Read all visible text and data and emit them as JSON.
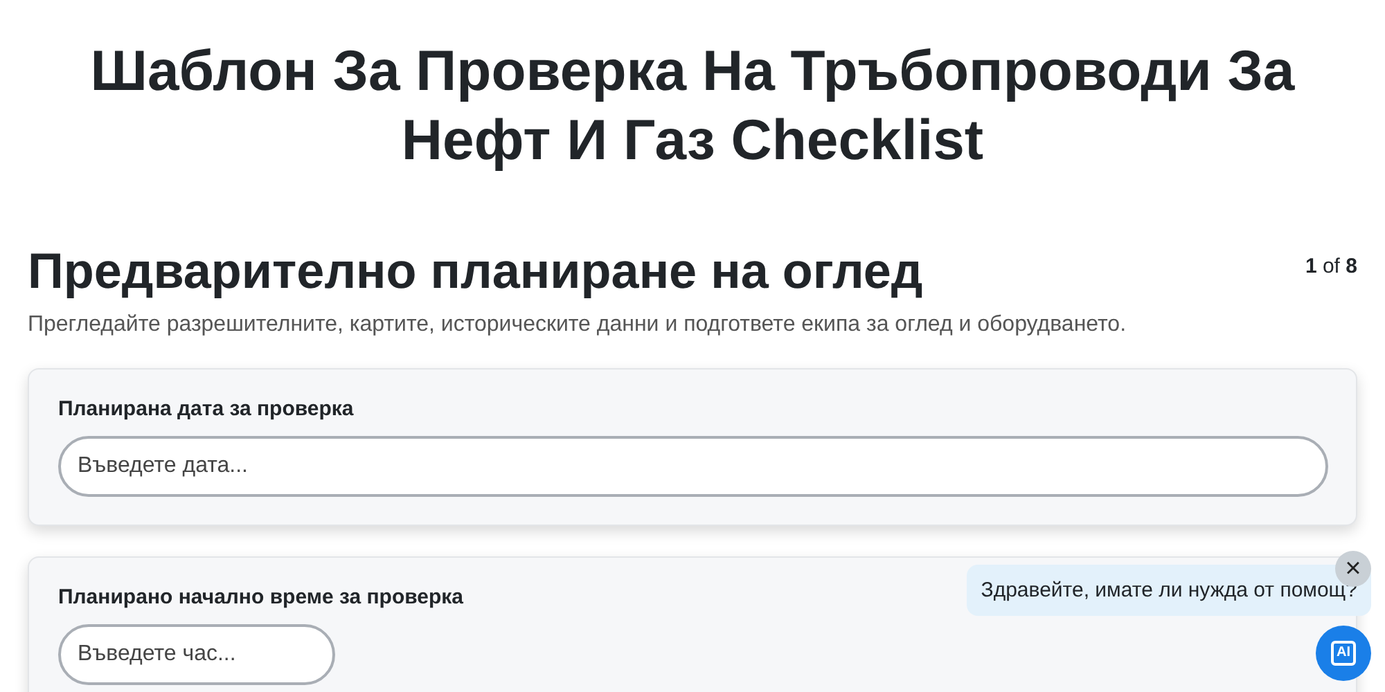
{
  "title": "Шаблон За Проверка На Тръбопроводи За Нефт И Газ Checklist",
  "section": {
    "heading": "Предварително планиране на оглед",
    "page": "1",
    "page_sep": "of",
    "page_total": "8",
    "description": "Прегледайте разрешителните, картите, историческите данни и подгответе екипа за оглед и оборудването."
  },
  "fields": [
    {
      "label": "Планирана дата за проверка",
      "placeholder": "Въведете дата...",
      "kind": "wide"
    },
    {
      "label": "Планирано начално време за проверка",
      "placeholder": "Въведете час...",
      "kind": "short"
    }
  ],
  "chat": {
    "message": "Здравейте, имате ли нужда от помощ?",
    "close": "×",
    "badge": "AI"
  }
}
